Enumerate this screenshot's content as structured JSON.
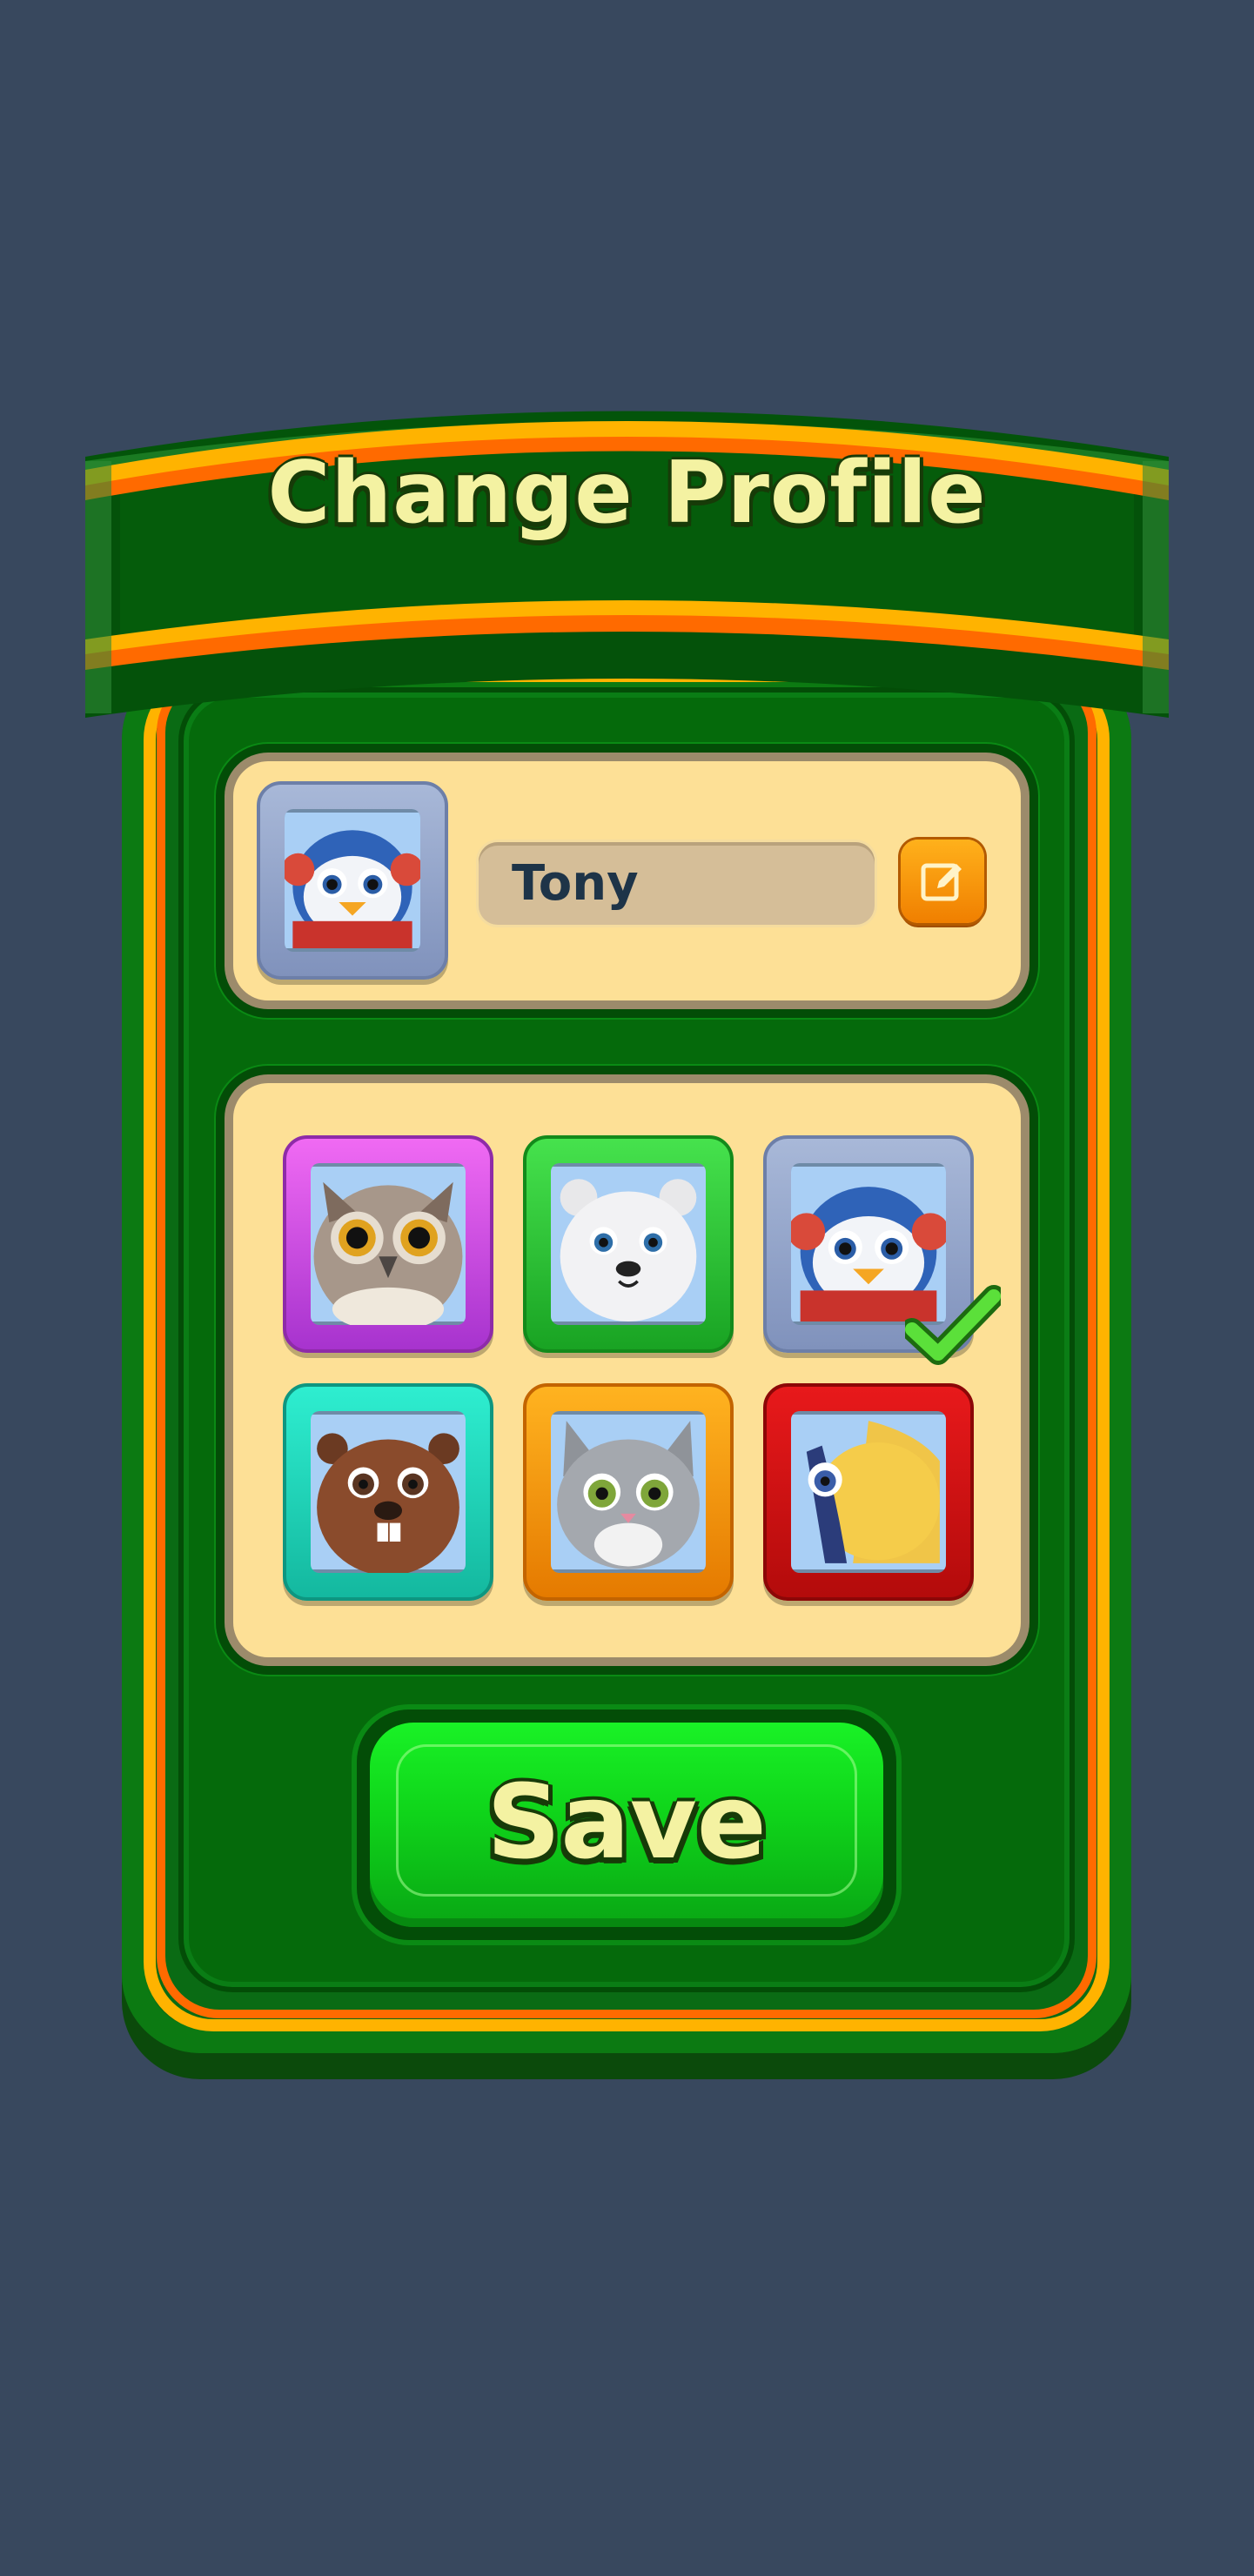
{
  "dialog": {
    "title": "Change Profile",
    "save_label": "Save"
  },
  "profile": {
    "name": "Tony",
    "current_avatar": "penguin"
  },
  "avatars": [
    {
      "animal": "owl",
      "frame_color": "#d04ee6",
      "selected": false
    },
    {
      "animal": "polar-bear",
      "frame_color": "#2fcc37",
      "selected": false
    },
    {
      "animal": "penguin",
      "frame_color": "#95a6cc",
      "selected": true
    },
    {
      "animal": "beaver",
      "frame_color": "#23d8bb",
      "selected": false
    },
    {
      "animal": "cat",
      "frame_color": "#f59a10",
      "selected": false
    },
    {
      "animal": "fish",
      "frame_color": "#d21212",
      "selected": false
    }
  ],
  "colors": {
    "background": "#38485e",
    "panel_green": "#056a0b",
    "card_cream": "#fde096",
    "title_text": "#f4f2a2",
    "save_green": "#0fd41a",
    "edit_orange": "#f59a10"
  },
  "icons": {
    "edit": "pencil-edit-icon",
    "selected": "checkmark-icon"
  }
}
